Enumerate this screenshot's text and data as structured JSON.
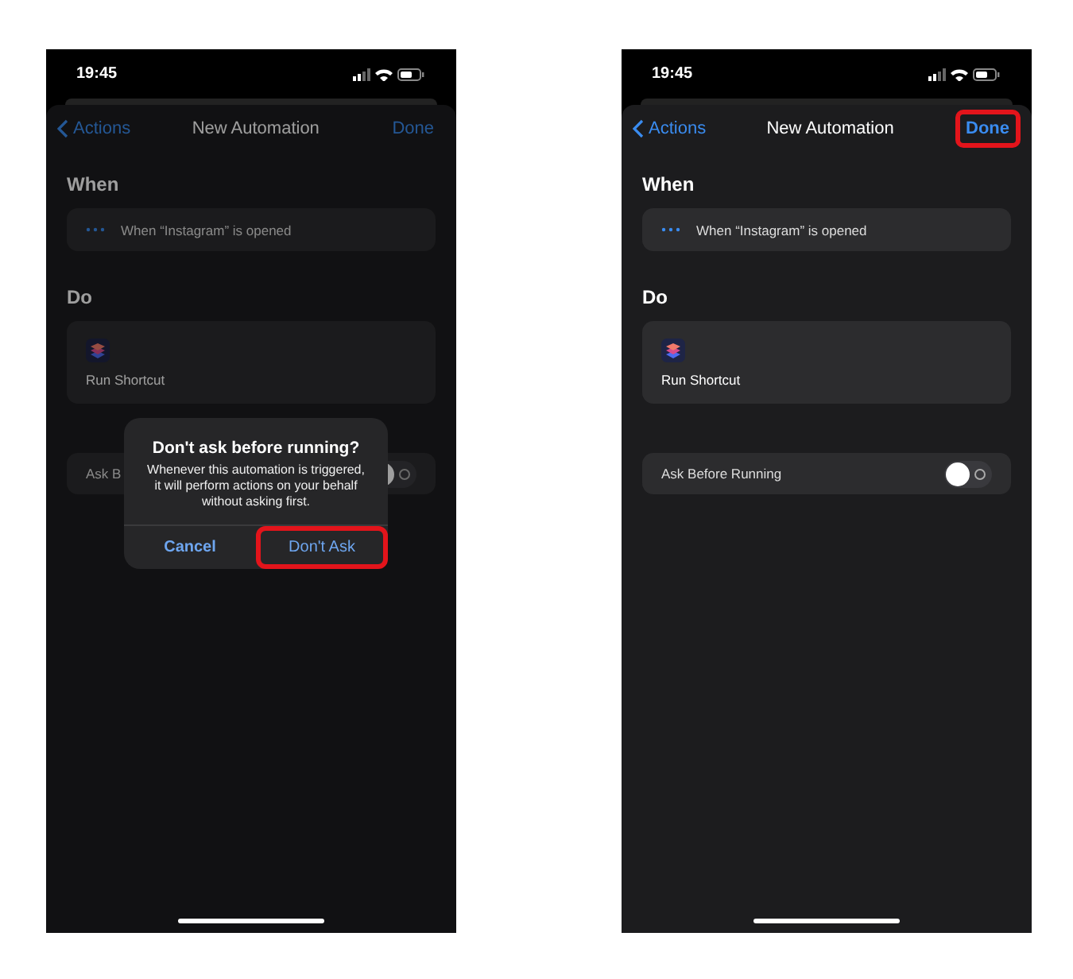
{
  "phones": [
    {
      "dimmed": true,
      "status": {
        "time": "19:45"
      },
      "nav": {
        "back": "Actions",
        "title": "New Automation",
        "done": {
          "label": "Done",
          "highlighted": false
        }
      },
      "when": {
        "heading": "When",
        "trigger": "When “Instagram” is opened"
      },
      "do": {
        "heading": "Do",
        "action": "Run Shortcut"
      },
      "setting": {
        "label": "Ask B",
        "on": false
      },
      "alert": {
        "title": "Don't ask before running?",
        "message": "Whenever this automation is triggered, it will perform actions on your behalf without asking first.",
        "buttons": [
          {
            "label": "Cancel",
            "kind": "cancel",
            "highlighted": false
          },
          {
            "label": "Don't Ask",
            "kind": "default",
            "highlighted": true
          }
        ]
      }
    },
    {
      "dimmed": false,
      "status": {
        "time": "19:45"
      },
      "nav": {
        "back": "Actions",
        "title": "New Automation",
        "done": {
          "label": "Done",
          "highlighted": true
        }
      },
      "when": {
        "heading": "When",
        "trigger": "When “Instagram” is opened"
      },
      "do": {
        "heading": "Do",
        "action": "Run Shortcut"
      },
      "setting": {
        "label": "Ask Before Running",
        "on": false
      }
    }
  ]
}
